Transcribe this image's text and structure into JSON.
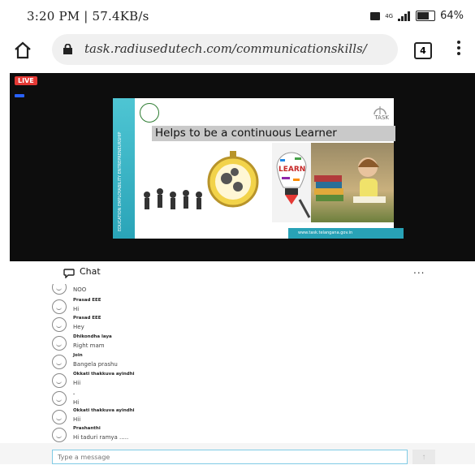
{
  "status_bar": {
    "time_speed": "3:20 PM | 57.4KB/s",
    "signal": "4G",
    "battery": "64%",
    "battery_level": 0.64
  },
  "browser": {
    "url": "task.radiusedutech.com/communicationskills/",
    "tab_count": "4",
    "icons": [
      "home-icon",
      "lock-icon",
      "tabs-icon",
      "menu-icon"
    ]
  },
  "video": {
    "live_badge": "LIVE",
    "slide_title": "Helps to be a continuous Learner",
    "slide_logo_text": "TASK",
    "slide_side_text": "EDUCATION   EMPLOYABILITY   ENTREPRENEURSHIP",
    "slide_footer": "www.task.telangana.gov.in",
    "slide_image_text": "LEARN"
  },
  "chat": {
    "title": "Chat",
    "more": "...",
    "messages": [
      {
        "name": "",
        "text": "NOO"
      },
      {
        "name": "Prasad EEE",
        "text": "Hi"
      },
      {
        "name": "Prasad EEE",
        "text": "Hey"
      },
      {
        "name": "Dhikondha laya",
        "text": "Right mam"
      },
      {
        "name": "Join",
        "text": "Bangela prashu"
      },
      {
        "name": "Okkati thakkuva ayindhi",
        "text": "Hii"
      },
      {
        "name": "",
        "text": "."
      },
      {
        "name": ".",
        "text": "Hi"
      },
      {
        "name": "Okkati thakkuva ayindhi",
        "text": "Hii"
      },
      {
        "name": "Prashanthi",
        "text": "Hi taduri ramya ....."
      }
    ],
    "input_placeholder": "Type a message",
    "send_icon": "arrow-up-icon"
  }
}
